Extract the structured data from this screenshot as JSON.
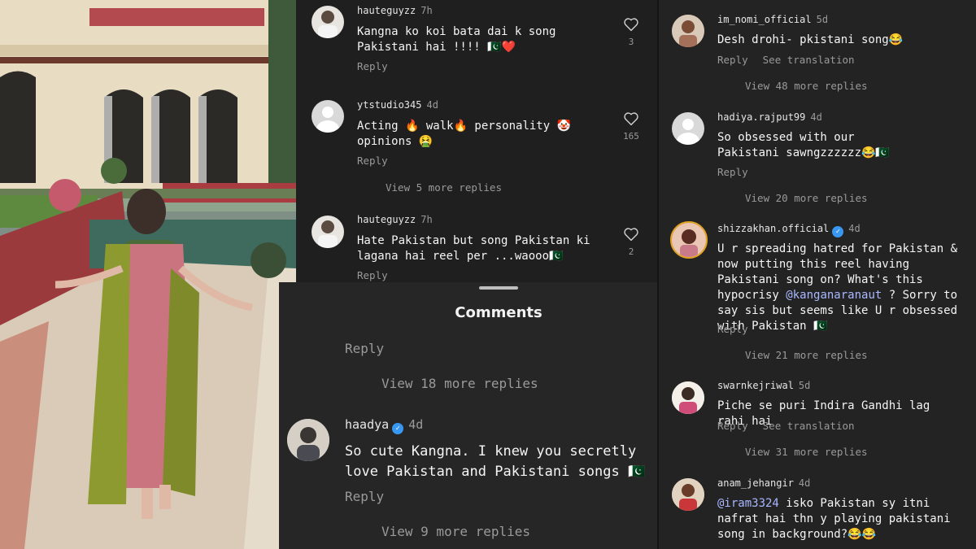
{
  "top_panel": {
    "comments": [
      {
        "username": "hauteguyzz",
        "time": "7h",
        "text": "Kangna ko koi bata dai k song Pakistani hai !!!! 🇵🇰❤️",
        "reply": "Reply",
        "likes": "3"
      },
      {
        "username": "ytstudio345",
        "time": "4d",
        "text": "Acting 🔥 walk🔥 personality 🤡 opinions 🤮",
        "reply": "Reply",
        "likes": "165",
        "more_replies": "View 5 more replies"
      },
      {
        "username": "hauteguyzz",
        "time": "7h",
        "text": "Hate Pakistan but song Pakistan ki lagana hai reel per ...waooo🇵🇰",
        "reply": "Reply",
        "likes": "2"
      }
    ]
  },
  "bottom_panel": {
    "title": "Comments",
    "prev_reply": "Reply",
    "prev_more_replies": "View 18 more replies",
    "comment": {
      "username": "haadya",
      "time": "4d",
      "text": "So cute Kangna. I knew you secretly love Pakistan and Pakistani songs 🇵🇰",
      "reply": "Reply",
      "more_replies": "View 9 more replies"
    }
  },
  "right_panel": {
    "comments": [
      {
        "username": "im_nomi_official",
        "time": "5d",
        "text": "Desh drohi- pkistani song😂",
        "reply": "Reply",
        "see_translation": "See translation",
        "more_replies": "View 48 more replies"
      },
      {
        "username": "hadiya.rajput99",
        "time": "4d",
        "text": "So obsessed with our Pakistani sawngzzzzzz😂🇵🇰",
        "reply": "Reply",
        "more_replies": "View 20 more replies"
      },
      {
        "username": "shizzakhan.official",
        "time": "4d",
        "text_before": "U r spreading hatred for Pakistan & now putting this reel having Pakistani song on? What's this hypocrisy ",
        "mention": "@kanganaranaut",
        "text_after": " ? Sorry to say sis but seems like U r obsessed with Pakistan 🇵🇰",
        "reply": "Reply",
        "more_replies": "View 21 more replies"
      },
      {
        "username": "swarnkejriwal",
        "time": "5d",
        "text": "Piche se puri Indira Gandhi lag rahi hai",
        "reply": "Reply",
        "see_translation": "See translation",
        "more_replies": "View 31 more replies"
      },
      {
        "username": "anam_jehangir",
        "time": "4d",
        "mention": "@iram3324",
        "text_after": " isko Pakistan sy itni nafrat hai thn y playing pakistani song in background?😂😂"
      }
    ]
  },
  "icons": {
    "like": "heart-outline-icon",
    "verified": "verified-badge-icon",
    "default_avatar": "default-avatar-icon"
  },
  "colors": {
    "background": "#1f1f1f",
    "muted_text": "#9a9a9a",
    "verified_blue": "#3897f0",
    "mention": "#a9b8ff"
  }
}
